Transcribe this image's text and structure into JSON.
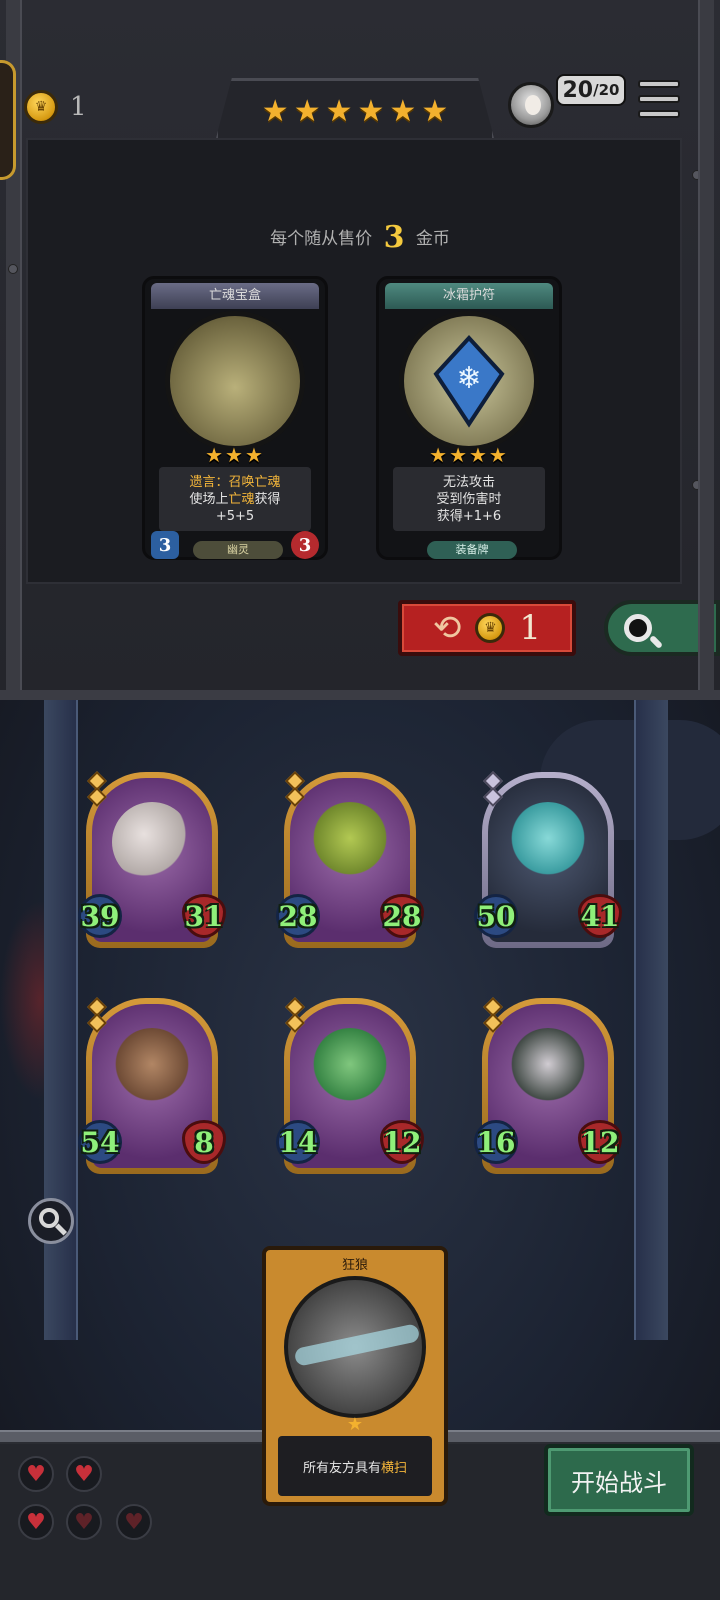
{
  "topbar": {
    "gold": "1",
    "tier_stars": 6,
    "population": "20",
    "population_max": "/20",
    "icons": {
      "gold": "crown-coin-icon",
      "avatar": "player-avatar-icon",
      "menu": "menu-icon"
    }
  },
  "shop": {
    "price_prefix": "每个随从售价",
    "price_value": "3",
    "price_suffix": "金币",
    "cards": [
      {
        "name": "亡魂宝盒",
        "stars": "★★★",
        "desc_line1_a": "遗言：召唤",
        "desc_line1_b": "亡魂",
        "desc_line2_a": "使场上",
        "desc_line2_b": "亡魂",
        "desc_line2_c": "获得",
        "desc_line3": "+5+5",
        "type": "幽灵",
        "attack": "3",
        "health": "3"
      },
      {
        "name": "冰霜护符",
        "stars": "★★★★",
        "desc_line1": "无法攻击",
        "desc_line2": "受到伤害时",
        "desc_line3": "获得+1+6",
        "type": "装备牌"
      }
    ],
    "reroll_cost": "1",
    "colors": {
      "reroll": "#b62121",
      "search": "#2e6b4e",
      "gold_text": "#f4c93e"
    }
  },
  "board": {
    "minions": [
      {
        "attack": "39",
        "health": "31"
      },
      {
        "attack": "28",
        "health": "28"
      },
      {
        "attack": "50",
        "health": "41"
      },
      {
        "attack": "54",
        "health": "8"
      },
      {
        "attack": "14",
        "health": "12"
      },
      {
        "attack": "16",
        "health": "12"
      }
    ]
  },
  "hero": {
    "name": "狂狼",
    "star": "★",
    "desc_a": "所有友方具有",
    "desc_b": "横扫"
  },
  "footer": {
    "lives_full": 3,
    "lives_total": 5,
    "start_label": "开始战斗",
    "heart_glyph": "♥"
  }
}
